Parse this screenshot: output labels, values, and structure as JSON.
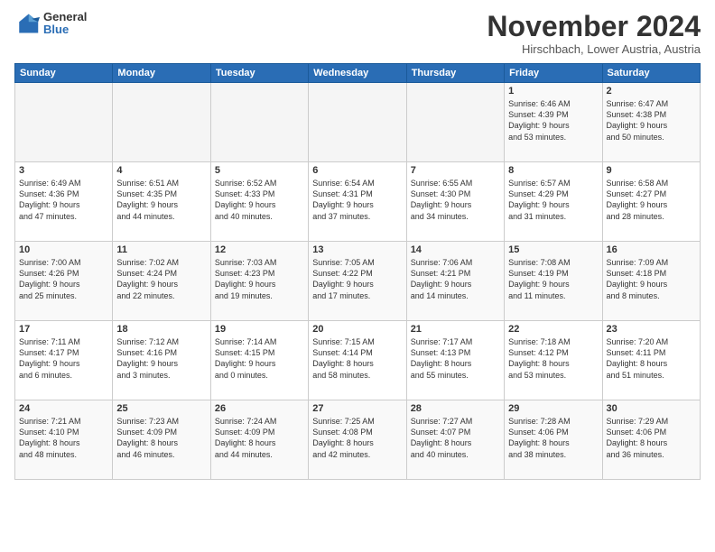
{
  "logo": {
    "general": "General",
    "blue": "Blue"
  },
  "title": "November 2024",
  "location": "Hirschbach, Lower Austria, Austria",
  "weekdays": [
    "Sunday",
    "Monday",
    "Tuesday",
    "Wednesday",
    "Thursday",
    "Friday",
    "Saturday"
  ],
  "weeks": [
    [
      {
        "day": "",
        "info": ""
      },
      {
        "day": "",
        "info": ""
      },
      {
        "day": "",
        "info": ""
      },
      {
        "day": "",
        "info": ""
      },
      {
        "day": "",
        "info": ""
      },
      {
        "day": "1",
        "info": "Sunrise: 6:46 AM\nSunset: 4:39 PM\nDaylight: 9 hours\nand 53 minutes."
      },
      {
        "day": "2",
        "info": "Sunrise: 6:47 AM\nSunset: 4:38 PM\nDaylight: 9 hours\nand 50 minutes."
      }
    ],
    [
      {
        "day": "3",
        "info": "Sunrise: 6:49 AM\nSunset: 4:36 PM\nDaylight: 9 hours\nand 47 minutes."
      },
      {
        "day": "4",
        "info": "Sunrise: 6:51 AM\nSunset: 4:35 PM\nDaylight: 9 hours\nand 44 minutes."
      },
      {
        "day": "5",
        "info": "Sunrise: 6:52 AM\nSunset: 4:33 PM\nDaylight: 9 hours\nand 40 minutes."
      },
      {
        "day": "6",
        "info": "Sunrise: 6:54 AM\nSunset: 4:31 PM\nDaylight: 9 hours\nand 37 minutes."
      },
      {
        "day": "7",
        "info": "Sunrise: 6:55 AM\nSunset: 4:30 PM\nDaylight: 9 hours\nand 34 minutes."
      },
      {
        "day": "8",
        "info": "Sunrise: 6:57 AM\nSunset: 4:29 PM\nDaylight: 9 hours\nand 31 minutes."
      },
      {
        "day": "9",
        "info": "Sunrise: 6:58 AM\nSunset: 4:27 PM\nDaylight: 9 hours\nand 28 minutes."
      }
    ],
    [
      {
        "day": "10",
        "info": "Sunrise: 7:00 AM\nSunset: 4:26 PM\nDaylight: 9 hours\nand 25 minutes."
      },
      {
        "day": "11",
        "info": "Sunrise: 7:02 AM\nSunset: 4:24 PM\nDaylight: 9 hours\nand 22 minutes."
      },
      {
        "day": "12",
        "info": "Sunrise: 7:03 AM\nSunset: 4:23 PM\nDaylight: 9 hours\nand 19 minutes."
      },
      {
        "day": "13",
        "info": "Sunrise: 7:05 AM\nSunset: 4:22 PM\nDaylight: 9 hours\nand 17 minutes."
      },
      {
        "day": "14",
        "info": "Sunrise: 7:06 AM\nSunset: 4:21 PM\nDaylight: 9 hours\nand 14 minutes."
      },
      {
        "day": "15",
        "info": "Sunrise: 7:08 AM\nSunset: 4:19 PM\nDaylight: 9 hours\nand 11 minutes."
      },
      {
        "day": "16",
        "info": "Sunrise: 7:09 AM\nSunset: 4:18 PM\nDaylight: 9 hours\nand 8 minutes."
      }
    ],
    [
      {
        "day": "17",
        "info": "Sunrise: 7:11 AM\nSunset: 4:17 PM\nDaylight: 9 hours\nand 6 minutes."
      },
      {
        "day": "18",
        "info": "Sunrise: 7:12 AM\nSunset: 4:16 PM\nDaylight: 9 hours\nand 3 minutes."
      },
      {
        "day": "19",
        "info": "Sunrise: 7:14 AM\nSunset: 4:15 PM\nDaylight: 9 hours\nand 0 minutes."
      },
      {
        "day": "20",
        "info": "Sunrise: 7:15 AM\nSunset: 4:14 PM\nDaylight: 8 hours\nand 58 minutes."
      },
      {
        "day": "21",
        "info": "Sunrise: 7:17 AM\nSunset: 4:13 PM\nDaylight: 8 hours\nand 55 minutes."
      },
      {
        "day": "22",
        "info": "Sunrise: 7:18 AM\nSunset: 4:12 PM\nDaylight: 8 hours\nand 53 minutes."
      },
      {
        "day": "23",
        "info": "Sunrise: 7:20 AM\nSunset: 4:11 PM\nDaylight: 8 hours\nand 51 minutes."
      }
    ],
    [
      {
        "day": "24",
        "info": "Sunrise: 7:21 AM\nSunset: 4:10 PM\nDaylight: 8 hours\nand 48 minutes."
      },
      {
        "day": "25",
        "info": "Sunrise: 7:23 AM\nSunset: 4:09 PM\nDaylight: 8 hours\nand 46 minutes."
      },
      {
        "day": "26",
        "info": "Sunrise: 7:24 AM\nSunset: 4:09 PM\nDaylight: 8 hours\nand 44 minutes."
      },
      {
        "day": "27",
        "info": "Sunrise: 7:25 AM\nSunset: 4:08 PM\nDaylight: 8 hours\nand 42 minutes."
      },
      {
        "day": "28",
        "info": "Sunrise: 7:27 AM\nSunset: 4:07 PM\nDaylight: 8 hours\nand 40 minutes."
      },
      {
        "day": "29",
        "info": "Sunrise: 7:28 AM\nSunset: 4:06 PM\nDaylight: 8 hours\nand 38 minutes."
      },
      {
        "day": "30",
        "info": "Sunrise: 7:29 AM\nSunset: 4:06 PM\nDaylight: 8 hours\nand 36 minutes."
      }
    ]
  ]
}
